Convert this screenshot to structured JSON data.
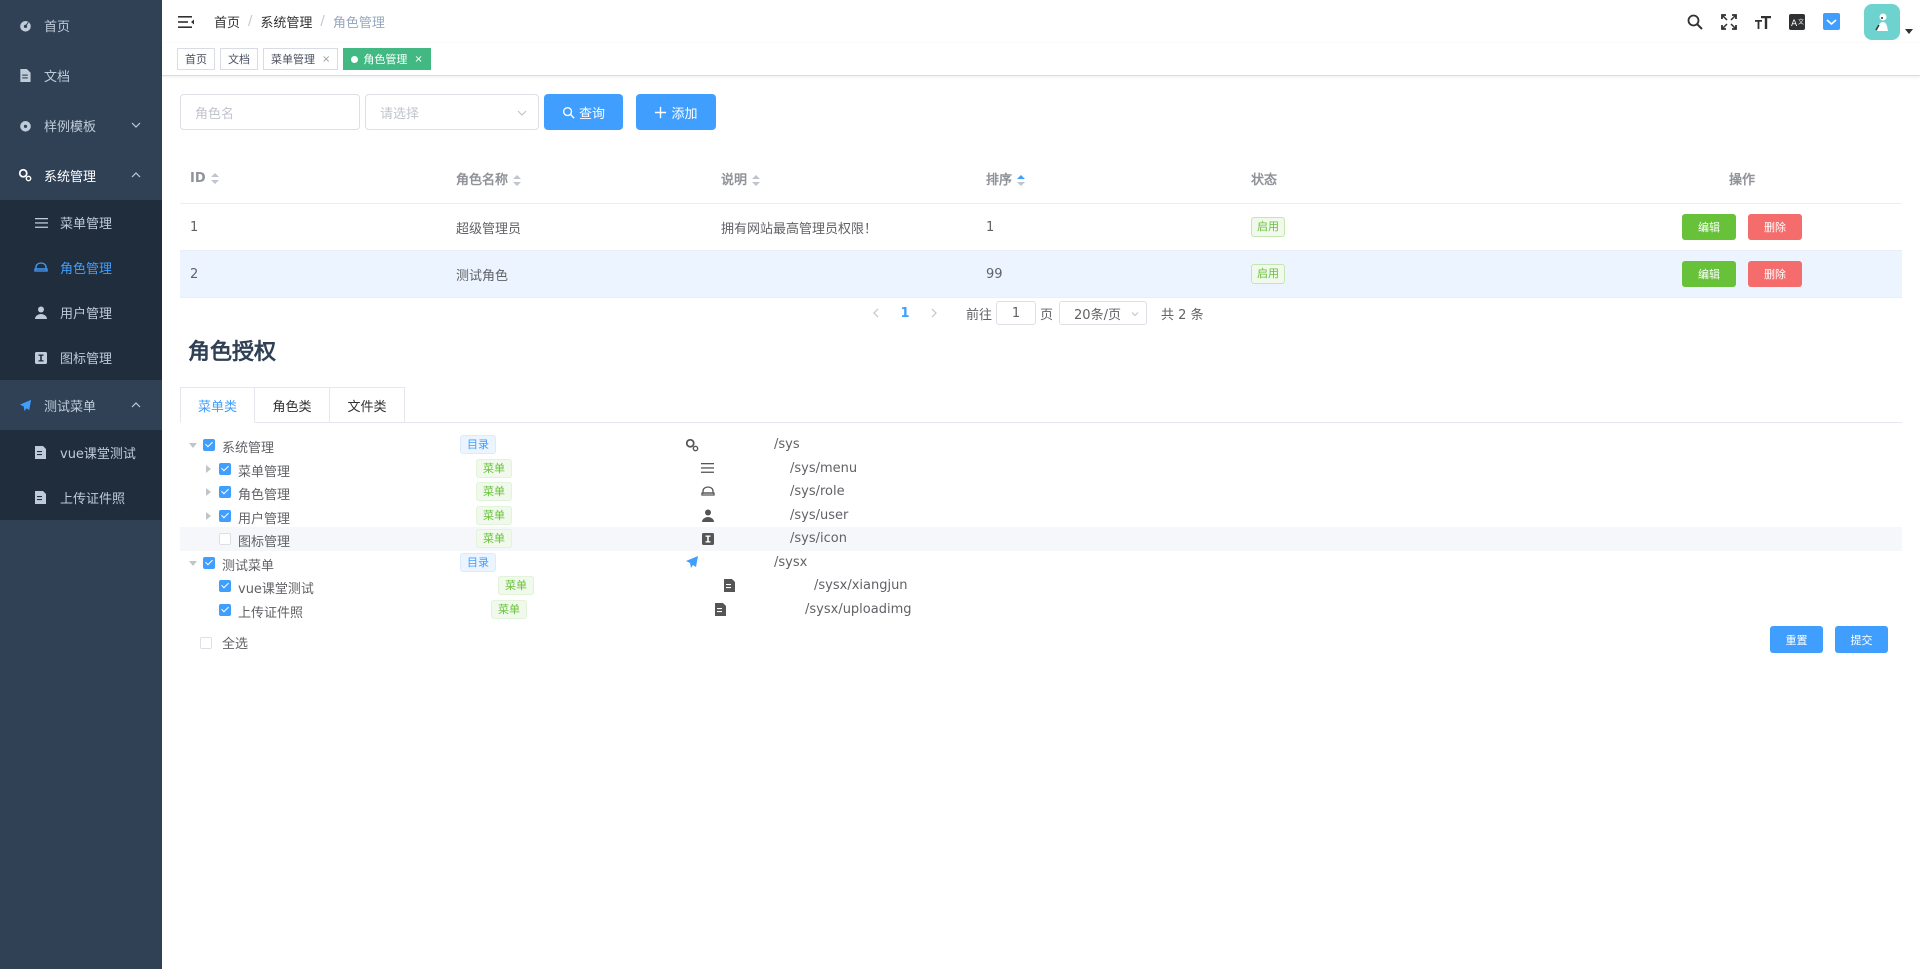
{
  "sidebar": {
    "items": [
      {
        "label": "首页",
        "icon": "dashboard-icon"
      },
      {
        "label": "文档",
        "icon": "document-icon"
      },
      {
        "label": "样例模板",
        "icon": "example-icon"
      },
      {
        "label": "系统管理",
        "icon": "gears-icon"
      },
      {
        "label": "测试菜单",
        "icon": "paper-plane-icon"
      }
    ],
    "system_sub": [
      {
        "label": "菜单管理",
        "icon": "list-icon"
      },
      {
        "label": "角色管理",
        "icon": "role-icon"
      },
      {
        "label": "用户管理",
        "icon": "user-icon"
      },
      {
        "label": "图标管理",
        "icon": "icon-box-icon"
      }
    ],
    "test_sub": [
      {
        "label": "vue课堂测试",
        "icon": "edit-doc-icon"
      },
      {
        "label": "上传证件照",
        "icon": "edit-doc-icon"
      }
    ]
  },
  "breadcrumb": [
    "首页",
    "系统管理",
    "角色管理"
  ],
  "tags": [
    {
      "label": "首页"
    },
    {
      "label": "文档"
    },
    {
      "label": "菜单管理",
      "close": "×"
    },
    {
      "label": "角色管理",
      "close": "×"
    }
  ],
  "filter": {
    "role_name_placeholder": "角色名",
    "select_placeholder": "请选择",
    "query_label": "查询",
    "add_label": "添加"
  },
  "table": {
    "headers": [
      "ID",
      "角色名称",
      "说明",
      "排序",
      "状态",
      "操作"
    ],
    "rows": [
      {
        "id": "1",
        "name": "超级管理员",
        "desc": "拥有网站最高管理员权限！",
        "sort": "1",
        "status": "启用"
      },
      {
        "id": "2",
        "name": "测试角色",
        "desc": "",
        "sort": "99",
        "status": "启用"
      }
    ],
    "edit_label": "编辑",
    "delete_label": "删除"
  },
  "pagination": {
    "current": "1",
    "goto_prefix": "前往",
    "goto_value": "1",
    "goto_suffix": "页",
    "page_size": "20条/页",
    "total": "共 2 条"
  },
  "permissions": {
    "title": "角色授权",
    "tabs": [
      "菜单类",
      "角色类",
      "文件类"
    ],
    "tree": [
      {
        "label": "系统管理",
        "tag": "目录",
        "path": "/sys",
        "checked": true
      },
      {
        "label": "菜单管理",
        "tag": "菜单",
        "path": "/sys/menu",
        "checked": true
      },
      {
        "label": "角色管理",
        "tag": "菜单",
        "path": "/sys/role",
        "checked": true
      },
      {
        "label": "用户管理",
        "tag": "菜单",
        "path": "/sys/user",
        "checked": true
      },
      {
        "label": "图标管理",
        "tag": "菜单",
        "path": "/sys/icon",
        "checked": false
      },
      {
        "label": "测试菜单",
        "tag": "目录",
        "path": "/sysx",
        "checked": true
      },
      {
        "label": "vue课堂测试",
        "tag": "菜单",
        "path": "/sysx/xiangjun",
        "checked": true
      },
      {
        "label": "上传证件照",
        "tag": "菜单",
        "path": "/sysx/uploadimg",
        "checked": true
      }
    ],
    "select_all": "全选",
    "reset_label": "重置",
    "submit_label": "提交"
  },
  "colors": {
    "sidebar_bg": "#304156",
    "primary": "#409eff",
    "success": "#67c23a",
    "danger": "#f56c6c",
    "active_tag": "#42b983"
  }
}
